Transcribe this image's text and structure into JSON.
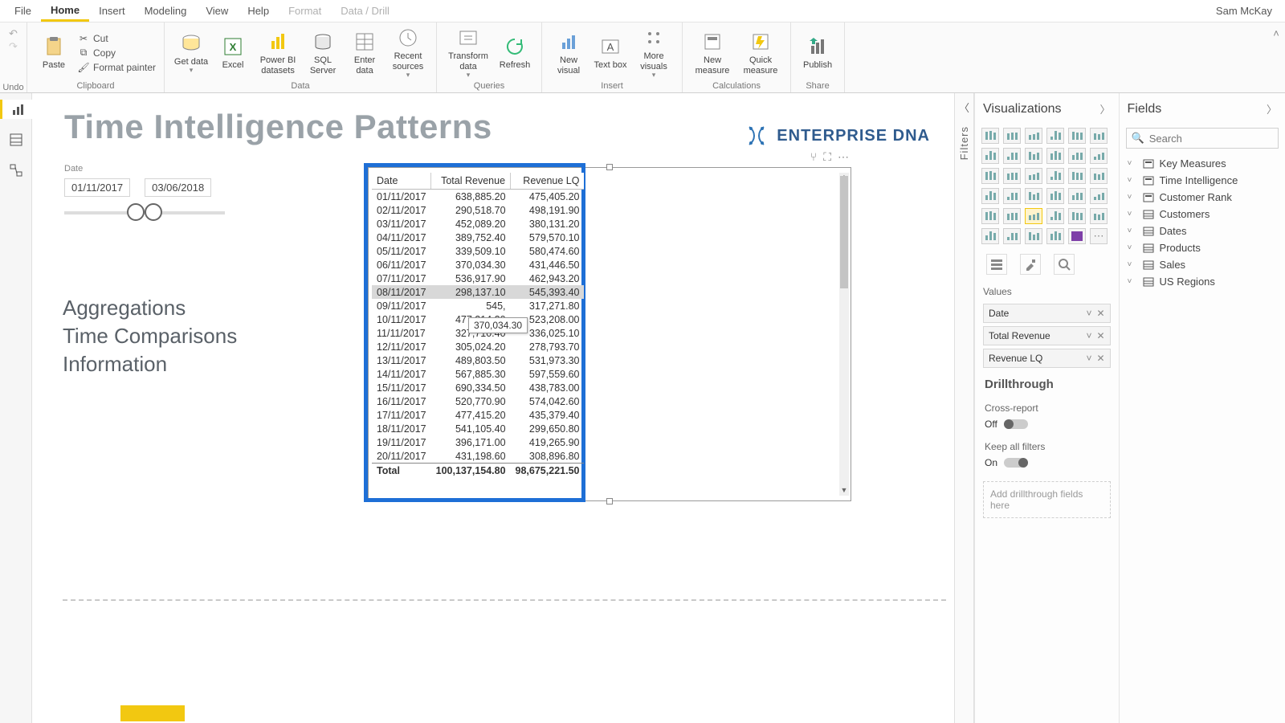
{
  "user": "Sam McKay",
  "menu": {
    "file": "File",
    "home": "Home",
    "insert": "Insert",
    "modeling": "Modeling",
    "view": "View",
    "help": "Help",
    "format": "Format",
    "datadrill": "Data / Drill"
  },
  "ribbon": {
    "undo": "Undo",
    "clipboard": {
      "label": "Clipboard",
      "paste": "Paste",
      "cut": "Cut",
      "copy": "Copy",
      "painter": "Format painter"
    },
    "data": {
      "label": "Data",
      "get": "Get data",
      "excel": "Excel",
      "pbi": "Power BI datasets",
      "sql": "SQL Server",
      "enter": "Enter data",
      "recent": "Recent sources"
    },
    "queries": {
      "label": "Queries",
      "transform": "Transform data",
      "refresh": "Refresh"
    },
    "insert": {
      "label": "Insert",
      "newvisual": "New visual",
      "textbox": "Text box",
      "more": "More visuals"
    },
    "calc": {
      "label": "Calculations",
      "newmeasure": "New measure",
      "quick": "Quick measure"
    },
    "share": {
      "label": "Share",
      "publish": "Publish"
    }
  },
  "page": {
    "title": "Time Intelligence Patterns",
    "brand": "ENTERPRISE DNA",
    "slicer": {
      "label": "Date",
      "from": "01/11/2017",
      "to": "03/06/2018"
    },
    "sideText": [
      "Aggregations",
      "Time Comparisons",
      "Information"
    ]
  },
  "filtersPane": {
    "label": "Filters"
  },
  "table": {
    "headers": [
      "Date",
      "Total Revenue",
      "Revenue LQ"
    ],
    "rows": [
      [
        "01/11/2017",
        "638,885.20",
        "475,405.20"
      ],
      [
        "02/11/2017",
        "290,518.70",
        "498,191.90"
      ],
      [
        "03/11/2017",
        "452,089.20",
        "380,131.20"
      ],
      [
        "04/11/2017",
        "389,752.40",
        "579,570.10"
      ],
      [
        "05/11/2017",
        "339,509.10",
        "580,474.60"
      ],
      [
        "06/11/2017",
        "370,034.30",
        "431,446.50"
      ],
      [
        "07/11/2017",
        "536,917.90",
        "462,943.20"
      ],
      [
        "08/11/2017",
        "298,137.10",
        "545,393.40"
      ],
      [
        "09/11/2017",
        "545,",
        "317,271.80"
      ],
      [
        "10/11/2017",
        "477,214.20",
        "523,208.00"
      ],
      [
        "11/11/2017",
        "327,710.40",
        "336,025.10"
      ],
      [
        "12/11/2017",
        "305,024.20",
        "278,793.70"
      ],
      [
        "13/11/2017",
        "489,803.50",
        "531,973.30"
      ],
      [
        "14/11/2017",
        "567,885.30",
        "597,559.60"
      ],
      [
        "15/11/2017",
        "690,334.50",
        "438,783.00"
      ],
      [
        "16/11/2017",
        "520,770.90",
        "574,042.60"
      ],
      [
        "17/11/2017",
        "477,415.20",
        "435,379.40"
      ],
      [
        "18/11/2017",
        "541,105.40",
        "299,650.80"
      ],
      [
        "19/11/2017",
        "396,171.00",
        "419,265.90"
      ],
      [
        "20/11/2017",
        "431,198.60",
        "308,896.80"
      ]
    ],
    "total": [
      "Total",
      "100,137,154.80",
      "98,675,221.50"
    ],
    "tooltip": "370,034.30",
    "highlightRow": 7
  },
  "viz": {
    "title": "Visualizations",
    "valuesLabel": "Values",
    "wells": [
      "Date",
      "Total Revenue",
      "Revenue LQ"
    ],
    "drill": "Drillthrough",
    "cross": "Cross-report",
    "off": "Off",
    "keep": "Keep all filters",
    "on": "On",
    "dropHint": "Add drillthrough fields here"
  },
  "fields": {
    "title": "Fields",
    "searchPh": "Search",
    "tables": [
      "Key Measures",
      "Time Intelligence",
      "Customer Rank",
      "Customers",
      "Dates",
      "Products",
      "Sales",
      "US Regions"
    ]
  }
}
